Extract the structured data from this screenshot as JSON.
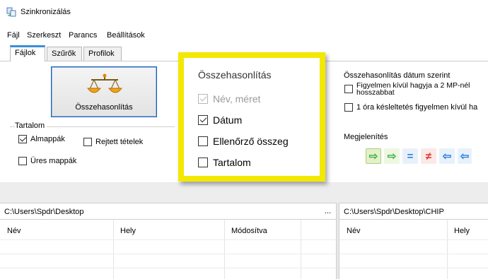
{
  "window": {
    "title": "Szinkronizálás",
    "icon": "sync-app-icon"
  },
  "menu": [
    "Fájl",
    "Szerkeszt",
    "Parancs",
    "Beállítások"
  ],
  "tabs": [
    {
      "label": "Fájlok",
      "active": true
    },
    {
      "label": "Szűrők",
      "active": false
    },
    {
      "label": "Profilok",
      "active": false
    }
  ],
  "compare_button": {
    "label": "Összehasonlítás",
    "icon": "scales-icon"
  },
  "content_group": {
    "title": "Tartalom",
    "items": [
      {
        "label": "Almappák",
        "checked": true
      },
      {
        "label": "Rejtett tételek",
        "checked": false
      },
      {
        "label": "Üres mappák",
        "checked": false
      }
    ]
  },
  "comparison_group": {
    "title": "Összehasonlítás",
    "items": [
      {
        "label": "Név, méret",
        "checked": true,
        "disabled": true
      },
      {
        "label": "Dátum",
        "checked": true,
        "disabled": false
      },
      {
        "label": "Ellenőrző összeg",
        "checked": false,
        "disabled": false
      },
      {
        "label": "Tartalom",
        "checked": false,
        "disabled": false
      }
    ]
  },
  "date_group": {
    "title": "Összehasonlítás dátum szerint",
    "item1_line1": "Figyelmen kívül hagyja a 2 MP-nél",
    "item1_line2": "hosszabbat",
    "item2": "1 óra késleltetés figyelmen kívül ha"
  },
  "display_group": {
    "title": "Megjelenítés",
    "buttons": [
      {
        "name": "copy-right-icon",
        "glyph": "⇨"
      },
      {
        "name": "arrow-right-icon",
        "glyph": "⇨"
      },
      {
        "name": "equal-icon",
        "glyph": "="
      },
      {
        "name": "not-equal-icon",
        "glyph": "≠"
      },
      {
        "name": "arrow-left-icon",
        "glyph": "⇦"
      },
      {
        "name": "arrow-left-partial-icon",
        "glyph": "⇦"
      }
    ]
  },
  "left_pane": {
    "path": "C:\\Users\\Spdr\\Desktop",
    "more": "...",
    "columns": [
      "Név",
      "Hely",
      "Módosítva"
    ]
  },
  "right_pane": {
    "path": "C:\\Users\\Spdr\\Desktop\\CHIP",
    "columns": [
      "Név",
      "Hely"
    ]
  },
  "colors": {
    "highlight": "#f2e800",
    "tab_accent": "#3a8fd6",
    "icon_green": "#3db04a",
    "icon_red": "#e0352b",
    "icon_blue": "#2b7fd6"
  }
}
